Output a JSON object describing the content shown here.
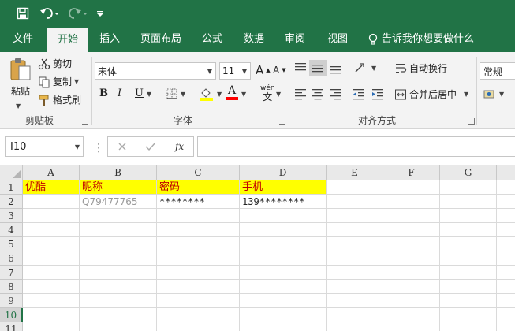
{
  "qat": {
    "save_icon": "save-icon",
    "undo_icon": "undo-icon",
    "redo_icon": "redo-icon",
    "customize_icon": "customize-qat-icon"
  },
  "tabs": [
    {
      "label": "文件"
    },
    {
      "label": "开始"
    },
    {
      "label": "插入"
    },
    {
      "label": "页面布局"
    },
    {
      "label": "公式"
    },
    {
      "label": "数据"
    },
    {
      "label": "审阅"
    },
    {
      "label": "视图"
    }
  ],
  "tell_me": "告诉我你想要做什么",
  "ribbon": {
    "clipboard": {
      "paste": "粘贴",
      "cut": "剪切",
      "copy": "复制",
      "format_painter": "格式刷",
      "label": "剪贴板"
    },
    "font": {
      "font_name": "宋体",
      "font_size": "11",
      "bold": "B",
      "italic": "I",
      "underline": "U",
      "font_color_letter": "A",
      "phonetic_top": "wén",
      "phonetic_bottom": "文",
      "grow": "A",
      "shrink": "A",
      "label": "字体"
    },
    "alignment": {
      "wrap_text": "自动换行",
      "merge_center": "合并后居中",
      "label": "对齐方式"
    },
    "number": {
      "format": "常规"
    },
    "colors": {
      "highlight": "#ffff00",
      "font_color": "#ff0000"
    }
  },
  "formula_bar": {
    "name_box": "I10",
    "fx": "fx",
    "content": ""
  },
  "sheet": {
    "columns": [
      "A",
      "B",
      "C",
      "D",
      "E",
      "F",
      "G"
    ],
    "rows": [
      "1",
      "2",
      "3",
      "4",
      "5",
      "6",
      "7",
      "8",
      "9",
      "10",
      "11"
    ],
    "row1": [
      "优酷",
      "昵称",
      "密码",
      "手机"
    ],
    "row2": [
      "",
      "Q79477765",
      "********",
      "139********"
    ],
    "selected_row": "10"
  }
}
